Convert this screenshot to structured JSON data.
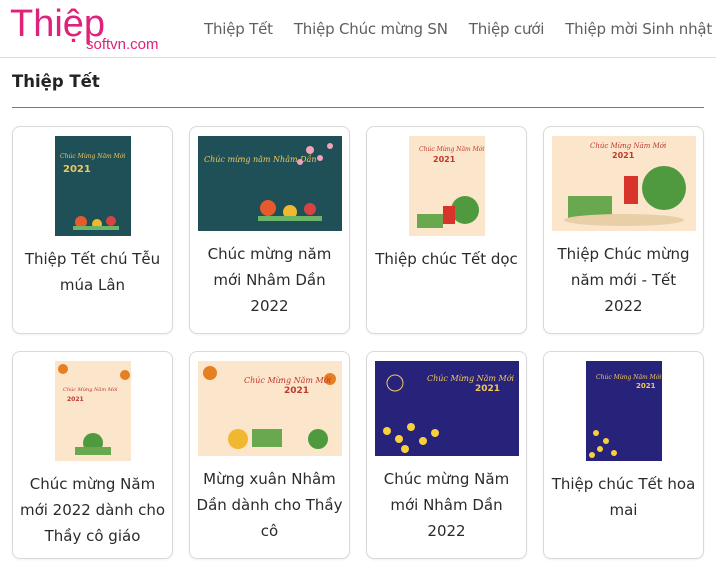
{
  "logo": {
    "main": "Thiệp",
    "sub": "softvn.com"
  },
  "nav": {
    "items": [
      {
        "label": "Thiệp Tết"
      },
      {
        "label": "Thiệp Chúc mừng SN"
      },
      {
        "label": "Thiệp cưới"
      },
      {
        "label": "Thiệp mời Sinh nhật"
      }
    ]
  },
  "section": {
    "title": "Thiệp Tết"
  },
  "cards": [
    {
      "title": "Thiệp Tết chú Tễu múa Lân",
      "thumb_text": "Chúc Mừng Năm Mới",
      "thumb_year": "2021",
      "theme": "teal"
    },
    {
      "title": "Chúc mừng năm mới Nhâm Dần 2022",
      "thumb_text": "Chúc mừng năm Nhâm Dần",
      "thumb_year": "",
      "theme": "teal"
    },
    {
      "title": "Thiệp chúc Tết dọc",
      "thumb_text": "Chúc Mừng Năm Mới",
      "thumb_year": "2021",
      "theme": "cream"
    },
    {
      "title": "Thiệp Chúc mừng năm mới - Tết 2022",
      "thumb_text": "Chúc Mừng Năm Mới",
      "thumb_year": "2021",
      "theme": "cream"
    },
    {
      "title": "Chúc mừng Năm mới 2022 dành cho Thầy cô giáo",
      "thumb_text": "Chúc Mừng Năm Mới",
      "thumb_year": "2021",
      "theme": "cream"
    },
    {
      "title": "Mừng xuân Nhâm Dần dành cho Thầy cô",
      "thumb_text": "Chúc Mừng Năm Mới",
      "thumb_year": "2021",
      "theme": "cream"
    },
    {
      "title": "Chúc mừng Năm mới Nhâm Dần 2022",
      "thumb_text": "Chúc Mừng Năm Mới",
      "thumb_year": "2021",
      "theme": "navy"
    },
    {
      "title": "Thiệp chúc Tết hoa mai",
      "thumb_text": "Chúc Mừng Năm Mới",
      "thumb_year": "2021",
      "theme": "navy"
    }
  ],
  "colors": {
    "brand_pink": "#e0217a",
    "teal_bg": "#1f4f57",
    "cream_bg": "#fbe6cc",
    "navy_bg": "#28237a",
    "nav_text": "#5f5f5f"
  }
}
